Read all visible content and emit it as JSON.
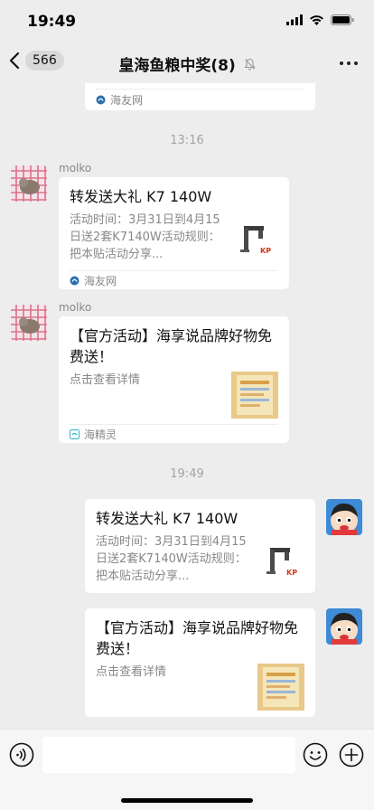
{
  "status_bar": {
    "time": "19:49"
  },
  "nav": {
    "back_count": "566",
    "title": "皇海鱼粮中奖(8)"
  },
  "timestamps": {
    "first": "13:16",
    "second": "19:49"
  },
  "messages": [
    {
      "source": "海友网"
    },
    {
      "sender": "molko",
      "title": "转发送大礼 K7 140W",
      "desc": "活动时间：3月31日到4月15日送2套K7140W活动规则：把本贴活动分享...",
      "source": "海友网"
    },
    {
      "sender": "molko",
      "title": "【官方活动】海享说品牌好物免费送！",
      "desc": "点击查看详情",
      "source": "海精灵"
    },
    {
      "title": "转发送大礼 K7 140W",
      "desc": "活动时间：3月31日到4月15日送2套K7140W活动规则：把本贴活动分享..."
    },
    {
      "title": "【官方活动】海享说品牌好物免费送！",
      "desc": "点击查看详情"
    }
  ],
  "colors": {
    "chat_bg": "#ededed",
    "card_bg": "#ffffff",
    "muted_text": "#888888"
  },
  "icons": [
    "back-chevron-icon",
    "mute-bell-icon",
    "more-icon",
    "voice-icon",
    "emoji-icon",
    "plus-icon"
  ]
}
